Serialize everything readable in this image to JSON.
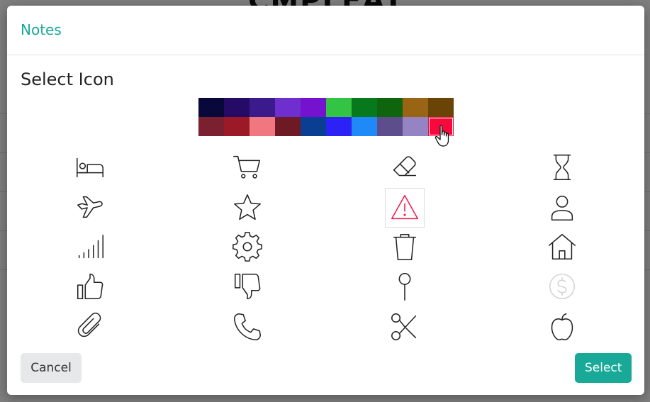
{
  "modal": {
    "title": "Notes",
    "section_title": "Select Icon",
    "cancel_label": "Cancel",
    "select_label": "Select"
  },
  "palette": {
    "colors": [
      "#08083a",
      "#250a66",
      "#3b1b8c",
      "#6e2fce",
      "#7412cf",
      "#34c445",
      "#07781b",
      "#0e650e",
      "#996514",
      "#6a4306",
      "#7a2030",
      "#9c1a28",
      "#f07780",
      "#6d1a24",
      "#0a3e93",
      "#2c22f6",
      "#2089f8",
      "#5e4d8c",
      "#9583c4",
      "#f7093d"
    ],
    "selected_index": 19
  },
  "icons": [
    {
      "name": "bed-icon"
    },
    {
      "name": "cart-icon"
    },
    {
      "name": "eraser-icon"
    },
    {
      "name": "hourglass-icon"
    },
    {
      "name": "airplane-icon"
    },
    {
      "name": "star-icon"
    },
    {
      "name": "warning-icon",
      "selected": true
    },
    {
      "name": "user-icon"
    },
    {
      "name": "signal-icon"
    },
    {
      "name": "gear-icon"
    },
    {
      "name": "trash-icon"
    },
    {
      "name": "home-icon"
    },
    {
      "name": "thumbs-up-icon"
    },
    {
      "name": "thumbs-down-icon"
    },
    {
      "name": "pin-icon"
    },
    {
      "name": "dollar-icon",
      "disabled": true
    },
    {
      "name": "paperclip-icon"
    },
    {
      "name": "phone-icon"
    },
    {
      "name": "scissors-icon"
    },
    {
      "name": "apple-icon"
    }
  ],
  "colors": {
    "accent": "#18a999",
    "selected_icon": "#f0194e"
  }
}
